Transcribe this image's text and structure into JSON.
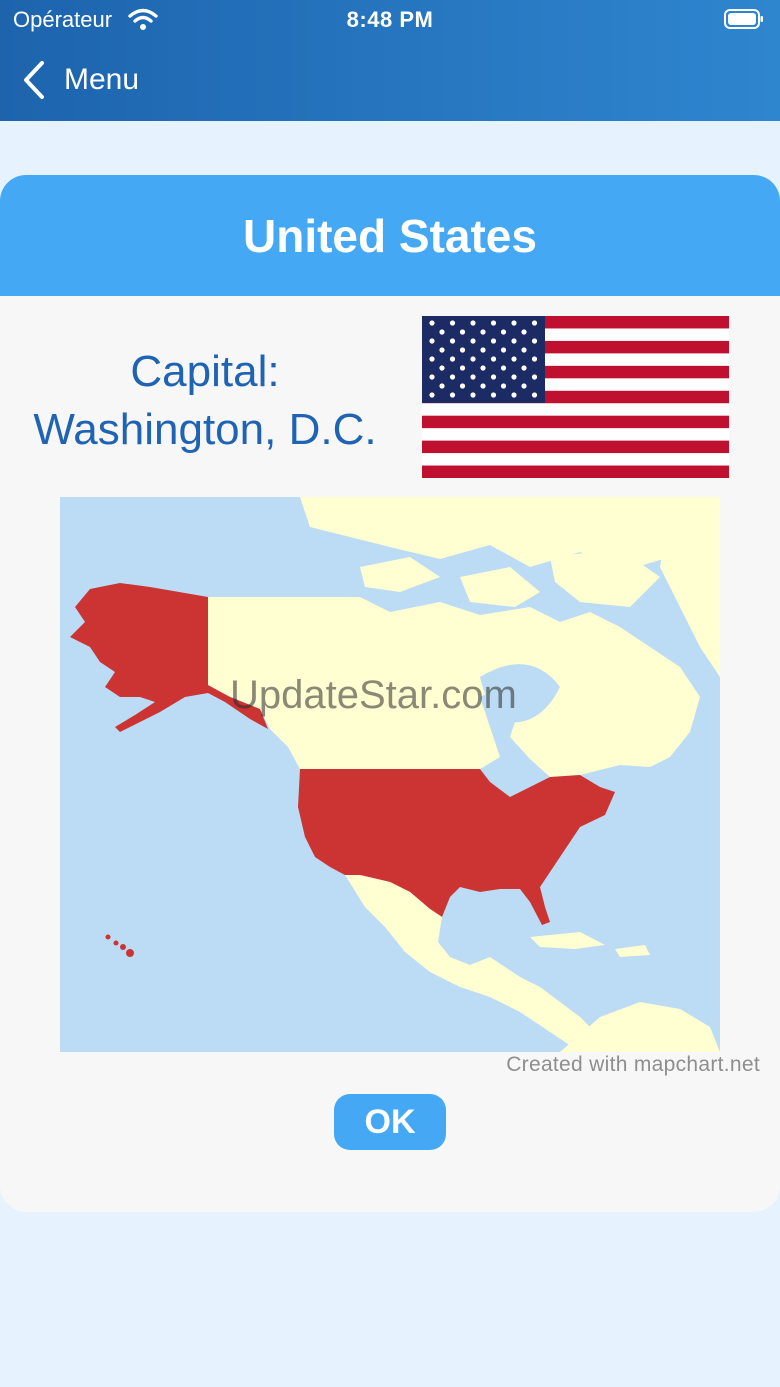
{
  "status_bar": {
    "carrier": "Opérateur",
    "time": "8:48 PM"
  },
  "nav": {
    "back_label": "Menu",
    "back_icon": "chevron-left-icon"
  },
  "card": {
    "country": "United States",
    "capital_label": "Capital:",
    "capital_value": "Washington, D.C.",
    "map_credit": "Created with mapchart.net",
    "ok_label": "OK",
    "highlight_color": "#cc3333",
    "land_color": "#ffffd2",
    "water_color": "#bcdcf5"
  },
  "watermark": "UpdateStar.com"
}
